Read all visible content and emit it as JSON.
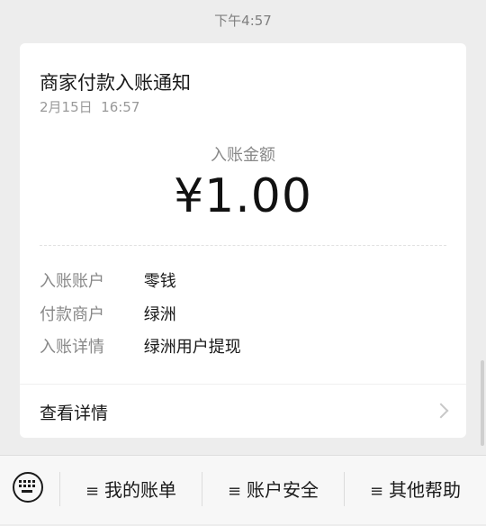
{
  "status": {
    "time": "下午4:57"
  },
  "card": {
    "title": "商家付款入账通知",
    "date": "2月15日  16:57",
    "amount_label": "入账金额",
    "amount": "¥1.00",
    "rows": [
      {
        "key": "入账账户",
        "value": "零钱"
      },
      {
        "key": "付款商户",
        "value": "绿洲"
      },
      {
        "key": "入账详情",
        "value": "绿洲用户提现"
      }
    ],
    "details_label": "查看详情"
  },
  "menu": {
    "items": [
      {
        "icon": "menu-lines-icon",
        "label": "我的账单"
      },
      {
        "icon": "menu-lines-icon",
        "label": "账户安全"
      },
      {
        "icon": "menu-lines-icon",
        "label": "其他帮助"
      }
    ],
    "keyboard_icon": "keyboard-icon"
  },
  "colors": {
    "background": "#ededed",
    "card": "#ffffff",
    "muted_text": "#888888",
    "primary_text": "#191919"
  }
}
